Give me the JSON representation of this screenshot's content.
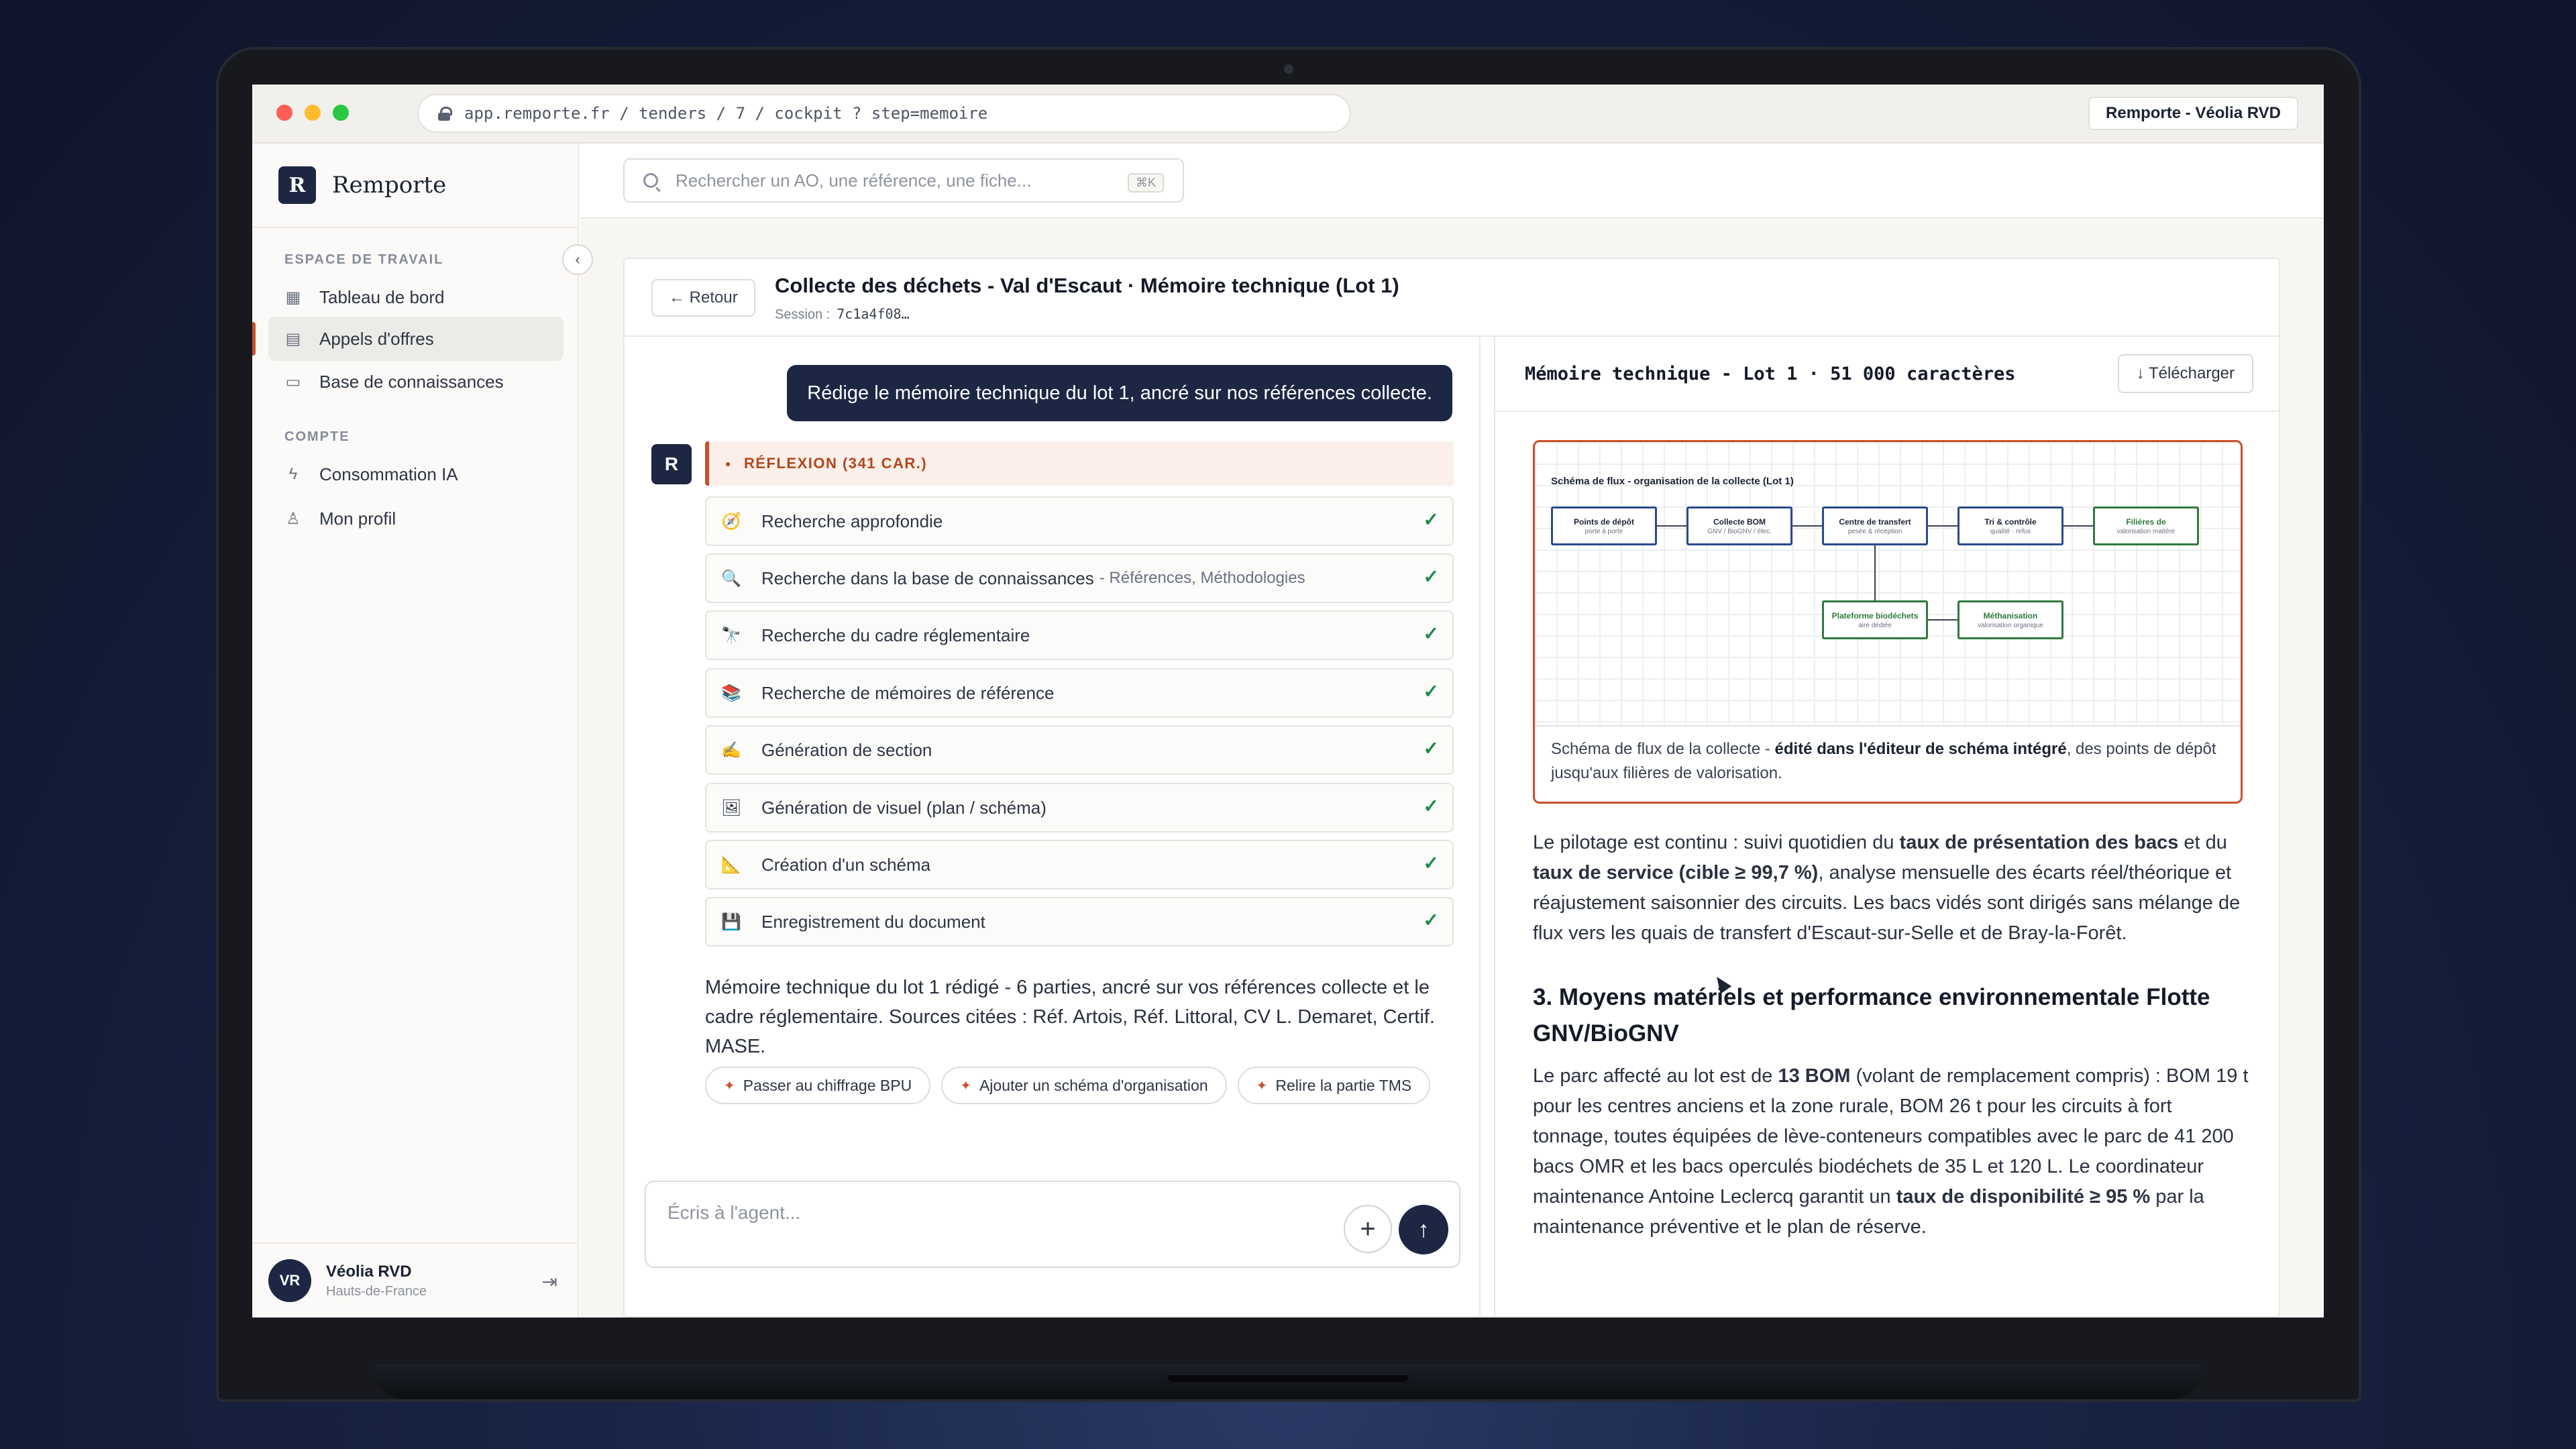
{
  "browser": {
    "url": "app.remporte.fr / tenders / 7 / cockpit ? step=memoire",
    "tab_label": "Remporte - Véolia RVD",
    "dots": {
      "red": "#ff5f57",
      "yellow": "#febc2e",
      "green": "#28c840"
    }
  },
  "sidebar": {
    "logo_mark": "R",
    "logo_text": "Remporte",
    "workspace_label": "ESPACE DE TRAVAIL",
    "workspace_items": [
      {
        "label": "Tableau de bord",
        "icon": "dashboard-icon"
      },
      {
        "label": "Appels d'offres",
        "icon": "document-icon",
        "active": true
      },
      {
        "label": "Base de connaissances",
        "icon": "folder-icon"
      }
    ],
    "account_label": "COMPTE",
    "account_items": [
      {
        "label": "Consommation IA",
        "icon": "bolt-icon"
      },
      {
        "label": "Mon profil",
        "icon": "user-icon"
      }
    ],
    "user": {
      "initials": "VR",
      "name": "Véolia RVD",
      "region": "Hauts-de-France"
    }
  },
  "search": {
    "placeholder": "Rechercher un AO, une référence, une fiche...",
    "shortcut": "⌘K"
  },
  "page": {
    "back_label": "← Retour",
    "title": "Collecte des déchets - Val d'Escaut · Mémoire technique (Lot 1)",
    "session_label": "Session :",
    "session_id": "7c1a4f08…"
  },
  "chat": {
    "user_message": "Rédige le mémoire technique du lot 1, ancré sur nos références collecte.",
    "agent_initial": "R",
    "reflection": "RÉFLEXION (341 CAR.)",
    "steps": [
      {
        "icon": "🧭",
        "label": "Recherche approfondie",
        "sub": ""
      },
      {
        "icon": "🔍",
        "label": "Recherche dans la base de connaissances",
        "sub": "- Références, Méthodologies"
      },
      {
        "icon": "🔭",
        "label": "Recherche du cadre réglementaire",
        "sub": ""
      },
      {
        "icon": "📚",
        "label": "Recherche de mémoires de référence",
        "sub": ""
      },
      {
        "icon": "✍",
        "label": "Génération de section",
        "sub": ""
      },
      {
        "icon": "🖼",
        "label": "Génération de visuel (plan / schéma)",
        "sub": ""
      },
      {
        "icon": "📐",
        "label": "Création d'un schéma",
        "sub": ""
      },
      {
        "icon": "💾",
        "label": "Enregistrement du document",
        "sub": ""
      }
    ],
    "answer": "Mémoire technique du lot 1 rédigé - 6 parties, ancré sur vos références collecte et le cadre réglementaire. Sources citées : Réf. Artois, Réf. Littoral, CV L. Demaret, Certif. MASE.",
    "chips": [
      "Passer au chiffrage BPU",
      "Ajouter un schéma d'organisation",
      "Relire la partie TMS"
    ],
    "composer_placeholder": "Écris à l'agent..."
  },
  "doc": {
    "title": "Mémoire technique - Lot 1 · 51 000 caractères",
    "download": "↓ Télécharger",
    "figure": {
      "title": "Schéma de flux - organisation de la collecte (Lot 1)",
      "nodes": [
        {
          "title": "Points de dépôt",
          "sub": "porte à porte"
        },
        {
          "title": "Collecte BOM",
          "sub": "GNV / BioGNV / élec."
        },
        {
          "title": "Centre de transfert",
          "sub": "pesée & réception"
        },
        {
          "title": "Tri & contrôle",
          "sub": "qualité · refus"
        },
        {
          "title": "Filières de",
          "sub": "valorisation matière"
        },
        {
          "title": "Plateforme biodéchets",
          "sub": "aire dédiée"
        },
        {
          "title": "Méthanisation",
          "sub": "valorisation organique"
        }
      ],
      "caption_pre": "Schéma de flux de la collecte - ",
      "caption_bold": "édité dans l'éditeur de schéma intégré",
      "caption_post": ", des points de dépôt jusqu'aux filières de valorisation."
    },
    "p1_a": "Le pilotage est continu : suivi quotidien du ",
    "p1_b": "taux de présentation des bacs",
    "p1_c": " et du ",
    "p1_d": "taux de service (cible ≥ 99,7 %)",
    "p1_e": ", analyse mensuelle des écarts réel/théorique et réajustement saisonnier des circuits. Les bacs vidés sont dirigés sans mélange de flux vers les quais de transfert d'Escaut-sur-Selle et de Bray-la-Forêt.",
    "h3": "3. Moyens matériels et performance environnementale Flotte GNV/BioGNV",
    "p2_a": "Le parc affecté au lot est de ",
    "p2_b": "13 BOM",
    "p2_c": " (volant de remplacement compris) : BOM 19 t pour les centres anciens et la zone rurale, BOM 26 t pour les circuits à fort tonnage, toutes équipées de lève-conteneurs compatibles avec le parc de 41 200 bacs OMR et les bacs operculés biodéchets de 35 L et 120 L. Le coordinateur maintenance Antoine Leclercq garantit un ",
    "p2_d": "taux de disponibilité ≥ 95 %",
    "p2_e": " par la maintenance préventive et le plan de réserve."
  }
}
